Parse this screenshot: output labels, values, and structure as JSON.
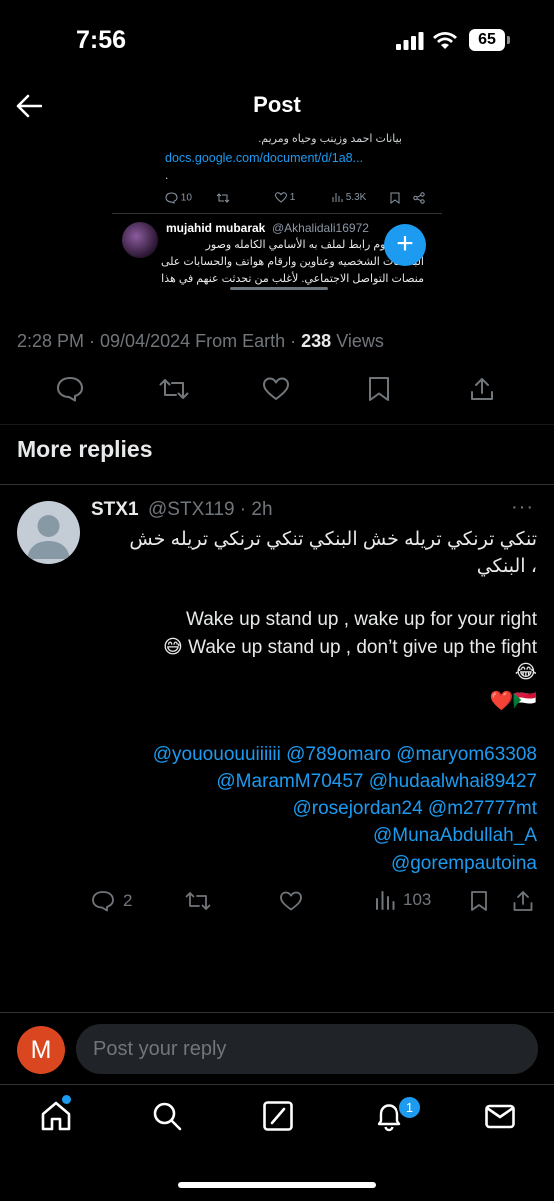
{
  "status": {
    "time": "7:56",
    "battery": "65"
  },
  "header": {
    "title": "Post"
  },
  "embed": {
    "arabic_top": "بيانات احمد وزينب وحياه ومريم.",
    "link": "docs.google.com/document/d/1a8...",
    "dot": ".",
    "replies": "10",
    "likes": "1",
    "views": "5.3K",
    "reply_name": "mujahid mubarak",
    "reply_handle": "@Akhalidali16972",
    "line1": "نشرنا اليوم رابط لملف به الأسامي الكامله وصور",
    "line2": "البطاقات الشخصيه وعناوين وارقام هواتف والحسابات على",
    "line3": "منصات التواصل الاجتماعي. لأغلب من تحدثت عنهم في هذا"
  },
  "meta": {
    "time_date": "2:28 PM · 09/04/2024 From Earth · ",
    "views_count": "238",
    "views_label": " Views"
  },
  "section": {
    "more_replies": "More replies"
  },
  "reply": {
    "name": "STX1",
    "handle": "@STX119 · 2h",
    "more": "···",
    "line1": "تنكي ترنكي تريله خش البنكي تنكي ترنكي تريله خش",
    "line2": "البنكي ،",
    "line3": "Wake up stand up , wake up for your right",
    "line4": "😅 Wake up stand up , don’t give up the fight",
    "line5": "😂",
    "line6": "❤️🇸🇩",
    "mentions": [
      "@youououuiiiiii @789omaro @maryom63308",
      "@MaramM70457 @hudaalwhai89427",
      "@rosejordan24 @m27777mt",
      "@MunaAbdullah_A",
      "@gorempautoina"
    ],
    "replies_count": "2",
    "views_count": "103"
  },
  "compose": {
    "avatar_letter": "M",
    "placeholder": "Post your reply"
  },
  "tabs": {
    "notifications_badge": "1"
  },
  "colors": {
    "accent": "#1d9bf0",
    "muted": "#71767b",
    "background": "#000000",
    "avatar_me": "#d9461f"
  }
}
